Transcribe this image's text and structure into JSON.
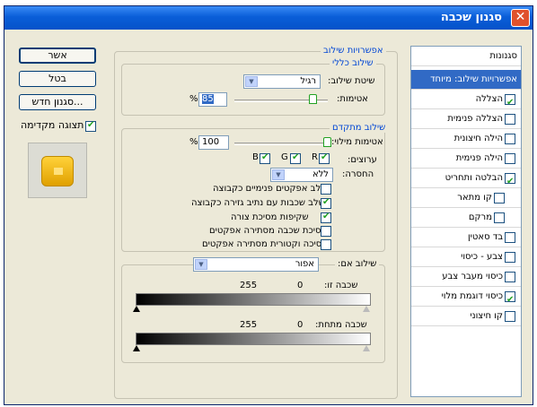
{
  "window": {
    "title": "סגנון שכבה"
  },
  "buttons": {
    "ok": "אשר",
    "cancel": "בטל",
    "new_style": "סגנון חדש...",
    "preview_label": "תצוגה מקדימה"
  },
  "styles_panel": {
    "header": "סגנונות",
    "items": [
      {
        "label": "אפשרויות שילוב: מיוחד",
        "checked": null,
        "selected": true
      },
      {
        "label": "הצללה",
        "checked": true
      },
      {
        "label": "הצללה פנימית",
        "checked": false
      },
      {
        "label": "הילה חיצונית",
        "checked": false
      },
      {
        "label": "הילה פנימית",
        "checked": false
      },
      {
        "label": "הבלטה ותחריט",
        "checked": true
      },
      {
        "label": "קו מתאר",
        "checked": false,
        "indent": true
      },
      {
        "label": "מרקם",
        "checked": false,
        "indent": true
      },
      {
        "label": "בד סאטין",
        "checked": false
      },
      {
        "label": "צבע - כיסוי",
        "checked": false
      },
      {
        "label": "כיסוי מעבר צבע",
        "checked": false
      },
      {
        "label": "כיסוי דוגמת מלוי",
        "checked": true
      },
      {
        "label": "קו חיצוני",
        "checked": false
      }
    ]
  },
  "blend_options": {
    "title": "אפשרויות שילוב",
    "general": {
      "title": "שילוב כללי",
      "mode_label": "שיטת שילוב:",
      "mode_value": "רגיל",
      "opacity_label": "אטימות:",
      "opacity_value": "85",
      "opacity_unit": "%",
      "opacity_fraction": 0.85
    },
    "advanced": {
      "title": "שילוב מתקדם",
      "fill_label": "אטימות מילוי:",
      "fill_value": "100",
      "fill_unit": "%",
      "fill_fraction": 1.0,
      "channels_label": "ערוצים:",
      "channels": [
        {
          "name": "R",
          "checked": true
        },
        {
          "name": "G",
          "checked": true
        },
        {
          "name": "B",
          "checked": true
        }
      ],
      "knockout_label": "החסרה:",
      "knockout_value": "ללא",
      "options": [
        {
          "label": "שלב אפקטים פנימיים כקבוצה",
          "checked": false
        },
        {
          "label": "שלב שכבות עם נתיב גזירה כקבוצה",
          "checked": true
        },
        {
          "label": "שקיפות מסיכת צורה",
          "checked": true
        },
        {
          "label": "מסיכת שכבה מסתירה אפקטים",
          "checked": false
        },
        {
          "label": "מסיכה וקטורית מסתירה אפקטים",
          "checked": false
        }
      ]
    },
    "blend_if": {
      "label": "שילוב אם:",
      "value": "אפור",
      "this_layer_label": "שכבה זו:",
      "this_layer_min": "0",
      "this_layer_max": "255",
      "underlying_label": "שכבה מתחת:",
      "underlying_min": "0",
      "underlying_max": "255"
    }
  },
  "icons": {
    "close": "close-icon",
    "dropdown": "chevron-down-icon",
    "check": "checkmark-icon"
  },
  "colors": {
    "title_bar": "#0a5ed8",
    "selection": "#316ac5",
    "group_title": "#0046d5",
    "check": "#21a121"
  }
}
